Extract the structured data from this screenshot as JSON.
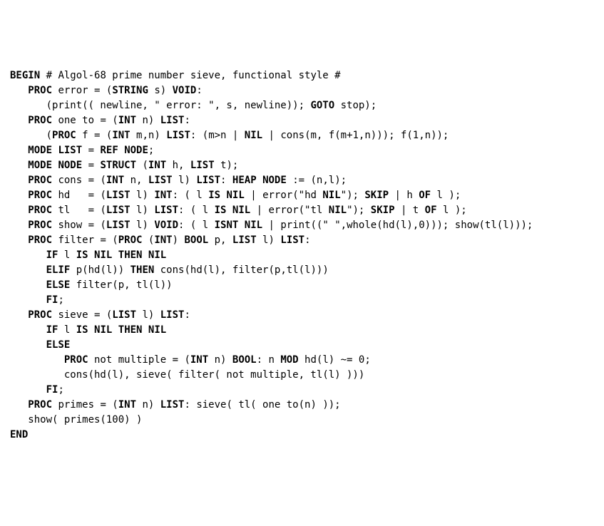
{
  "code": {
    "l00a": "BEGIN",
    "l00b": " # Algol-68 prime number sieve, functional style #",
    "blank": "",
    "l01a": "   ",
    "l01b": "PROC",
    "l01c": " error = (",
    "l01d": "STRING",
    "l01e": " s) ",
    "l01f": "VOID",
    "l01g": ":",
    "l02a": "      (print(( newline, \" error: \", s, newline)); ",
    "l02b": "GOTO",
    "l02c": " stop);",
    "l03a": "   ",
    "l03b": "PROC",
    "l03c": " one to = (",
    "l03d": "INT",
    "l03e": " n) ",
    "l03f": "LIST",
    "l03g": ":",
    "l04a": "      (",
    "l04b": "PROC",
    "l04c": " f = (",
    "l04d": "INT",
    "l04e": " m,n) ",
    "l04f": "LIST",
    "l04g": ": (m>n | ",
    "l04h": "NIL",
    "l04i": " | cons(m, f(m+1,n))); f(1,n));",
    "l05a": "   ",
    "l05b": "MODE",
    "l05c": " ",
    "l05d": "LIST",
    "l05e": " = ",
    "l05f": "REF",
    "l05g": " ",
    "l05h": "NODE",
    "l05i": ";",
    "l06a": "   ",
    "l06b": "MODE",
    "l06c": " ",
    "l06d": "NODE",
    "l06e": " = ",
    "l06f": "STRUCT",
    "l06g": " (",
    "l06h": "INT",
    "l06i": " h, ",
    "l06j": "LIST",
    "l06k": " t);",
    "l07a": "   ",
    "l07b": "PROC",
    "l07c": " cons = (",
    "l07d": "INT",
    "l07e": " n, ",
    "l07f": "LIST",
    "l07g": " l) ",
    "l07h": "LIST",
    "l07i": ": ",
    "l07j": "HEAP",
    "l07k": " ",
    "l07l": "NODE",
    "l07m": " := (n,l);",
    "l08a": "   ",
    "l08b": "PROC",
    "l08c": " hd   = (",
    "l08d": "LIST",
    "l08e": " l) ",
    "l08f": "INT",
    "l08g": ": ( l ",
    "l08h": "IS",
    "l08i": " ",
    "l08j": "NIL",
    "l08k": " | error(\"hd ",
    "l08l": "NIL",
    "l08m": "\"); ",
    "l08n": "SKIP",
    "l08o": " | h ",
    "l08p": "OF",
    "l08q": " l );",
    "l09a": "   ",
    "l09b": "PROC",
    "l09c": " tl   = (",
    "l09d": "LIST",
    "l09e": " l) ",
    "l09f": "LIST",
    "l09g": ": ( l ",
    "l09h": "IS",
    "l09i": " ",
    "l09j": "NIL",
    "l09k": " | error(\"tl ",
    "l09l": "NIL",
    "l09m": "\"); ",
    "l09n": "SKIP",
    "l09o": " | t ",
    "l09p": "OF",
    "l09q": " l );",
    "l10a": "   ",
    "l10b": "PROC",
    "l10c": " show = (",
    "l10d": "LIST",
    "l10e": " l) ",
    "l10f": "VOID",
    "l10g": ": ( l ",
    "l10h": "ISNT",
    "l10i": " ",
    "l10j": "NIL",
    "l10k": " | print((\" \",whole(hd(l),0))); show(tl(l)));",
    "l11a": "   ",
    "l11b": "PROC",
    "l11c": " filter = (",
    "l11d": "PROC",
    "l11e": " (",
    "l11f": "INT",
    "l11g": ") ",
    "l11h": "BOOL",
    "l11i": " p, ",
    "l11j": "LIST",
    "l11k": " l) ",
    "l11l": "LIST",
    "l11m": ":",
    "l12a": "      ",
    "l12b": "IF",
    "l12c": " l ",
    "l12d": "IS",
    "l12e": " ",
    "l12f": "NIL",
    "l12g": " ",
    "l12h": "THEN",
    "l12i": " ",
    "l12j": "NIL",
    "l13a": "      ",
    "l13b": "ELIF",
    "l13c": " p(hd(l)) ",
    "l13d": "THEN",
    "l13e": " cons(hd(l), filter(p,tl(l)))",
    "l14a": "      ",
    "l14b": "ELSE",
    "l14c": " filter(p, tl(l))",
    "l15a": "      ",
    "l15b": "FI",
    "l15c": ";",
    "l16a": "   ",
    "l16b": "PROC",
    "l16c": " sieve = (",
    "l16d": "LIST",
    "l16e": " l) ",
    "l16f": "LIST",
    "l16g": ":",
    "l17a": "      ",
    "l17b": "IF",
    "l17c": " l ",
    "l17d": "IS",
    "l17e": " ",
    "l17f": "NIL",
    "l17g": " ",
    "l17h": "THEN",
    "l17i": " ",
    "l17j": "NIL",
    "l18a": "      ",
    "l18b": "ELSE",
    "l19a": "         ",
    "l19b": "PROC",
    "l19c": " not multiple = (",
    "l19d": "INT",
    "l19e": " n) ",
    "l19f": "BOOL",
    "l19g": ": n ",
    "l19h": "MOD",
    "l19i": " hd(l) ~= 0;",
    "l20a": "         cons(hd(l), sieve( filter( not multiple, tl(l) )))",
    "l21a": "      ",
    "l21b": "FI",
    "l21c": ";",
    "l22a": "   ",
    "l22b": "PROC",
    "l22c": " primes = (",
    "l22d": "INT",
    "l22e": " n) ",
    "l22f": "LIST",
    "l22g": ": sieve( tl( one to(n) ));",
    "l23a": "   show( primes(100) )",
    "l24a": "END"
  }
}
